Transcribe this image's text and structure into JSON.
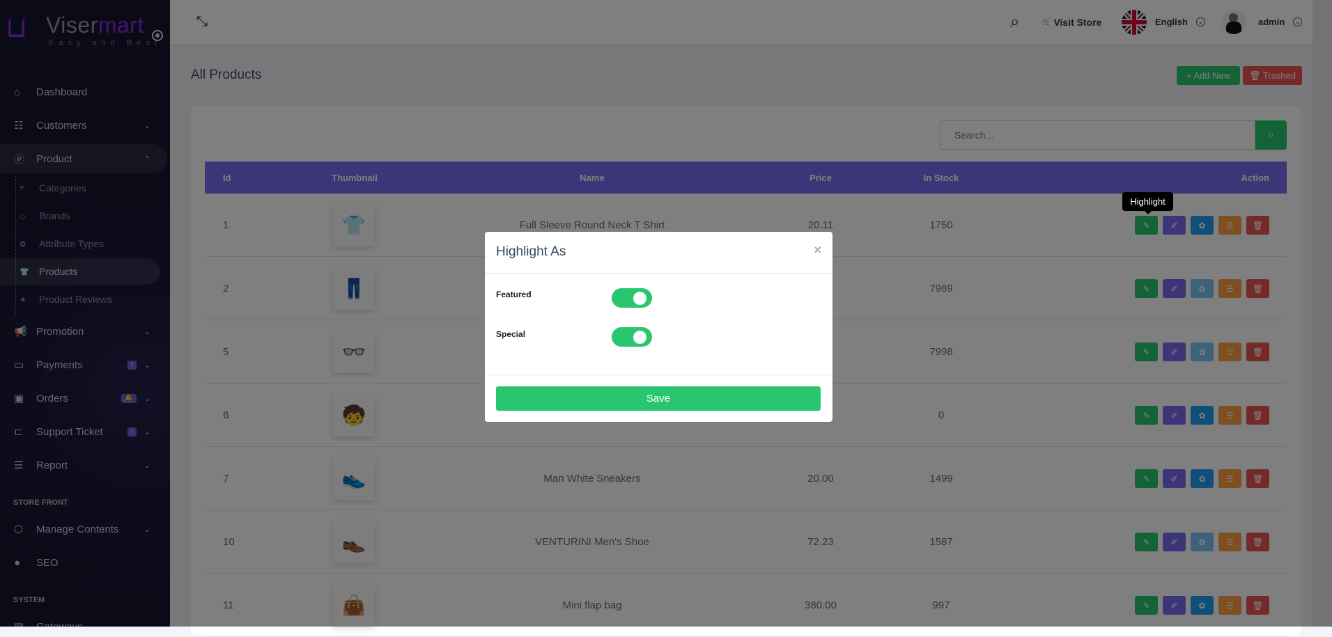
{
  "brand": {
    "name_a": "Viser",
    "name_b": "mart",
    "tagline": "Easy and Best"
  },
  "sidebar": {
    "items": [
      {
        "label": "Dashboard",
        "icon": "⌂"
      },
      {
        "label": "Customers",
        "icon": "☷",
        "chevron": "⌄"
      },
      {
        "label": "Product",
        "icon": "ⓟ",
        "chevron": "⌃"
      },
      {
        "label": "Promotion",
        "icon": "📢",
        "chevron": "⌄"
      },
      {
        "label": "Payments",
        "icon": "▭",
        "chevron": "⌄",
        "badge": "!"
      },
      {
        "label": "Orders",
        "icon": "▣",
        "chevron": "⌄",
        "badge": "🔔"
      },
      {
        "label": "Support Ticket",
        "icon": "⊏",
        "chevron": "⌄",
        "badge": "!"
      },
      {
        "label": "Report",
        "icon": "☰",
        "chevron": "⌄"
      }
    ],
    "product_sub": [
      {
        "label": "Categories",
        "icon": "≡"
      },
      {
        "label": "Brands",
        "icon": "◇"
      },
      {
        "label": "Attribute Types",
        "icon": "✿"
      },
      {
        "label": "Products",
        "icon": "👕"
      },
      {
        "label": "Product Reviews",
        "icon": "★"
      }
    ],
    "section_store": "STORE FRONT",
    "store_items": [
      {
        "label": "Manage Contents",
        "icon": "⬡",
        "chevron": "⌄"
      },
      {
        "label": "SEO",
        "icon": "●"
      }
    ],
    "section_system": "SYSTEM",
    "system_items": [
      {
        "label": "Gateways",
        "icon": "▤"
      }
    ]
  },
  "topbar": {
    "fullscreen_icon": "⤡",
    "search_icon": "⌕",
    "visit_store": "Visit Store",
    "cart_icon": "🛒",
    "language": "English",
    "user": "admin",
    "dropdown_icon": "⌄"
  },
  "page": {
    "title": "All Products",
    "add_new": "+ Add New",
    "trashed": "🗑 Trashed",
    "search_placeholder": "Search..."
  },
  "table": {
    "headers": [
      "Id",
      "Thumbnail",
      "Name",
      "Price",
      "In Stock",
      "Action"
    ],
    "rows": [
      {
        "id": "1",
        "thumb": "👕",
        "name": "Full Sleeve Round Neck T Shirt",
        "price": "20.11",
        "stock": "1750",
        "third_btn": "blue"
      },
      {
        "id": "2",
        "thumb": "👖",
        "name": "",
        "price": "",
        "stock": "7989",
        "third_btn": "light"
      },
      {
        "id": "5",
        "thumb": "👓",
        "name": "",
        "price": "",
        "stock": "7998",
        "third_btn": "light"
      },
      {
        "id": "6",
        "thumb": "🧒",
        "name": "",
        "price": "",
        "stock": "0",
        "third_btn": "blue"
      },
      {
        "id": "7",
        "thumb": "👟",
        "name": "Man White Sneakers",
        "price": "20.00",
        "stock": "1499",
        "third_btn": "blue"
      },
      {
        "id": "10",
        "thumb": "👞",
        "name": "VENTURINI Men's Shoe",
        "price": "72.23",
        "stock": "1587",
        "third_btn": "light"
      },
      {
        "id": "11",
        "thumb": "👜",
        "name": "Mini flap bag",
        "price": "380.00",
        "stock": "997",
        "third_btn": "blue"
      }
    ],
    "action_icons": [
      "✎",
      "✐",
      "✿",
      "☰",
      "🗑"
    ]
  },
  "tooltip": "Highlight",
  "modal": {
    "title": "Highlight As",
    "close": "×",
    "fields": [
      {
        "label": "Featured",
        "on": true
      },
      {
        "label": "Special",
        "on": true
      }
    ],
    "save": "Save"
  },
  "colors": {
    "primary": "#786af0",
    "success": "#28c76f",
    "danger": "#ea5455",
    "warning": "#ff9f43",
    "info": "#1e9ff2",
    "info_light": "#7cc4f2"
  }
}
